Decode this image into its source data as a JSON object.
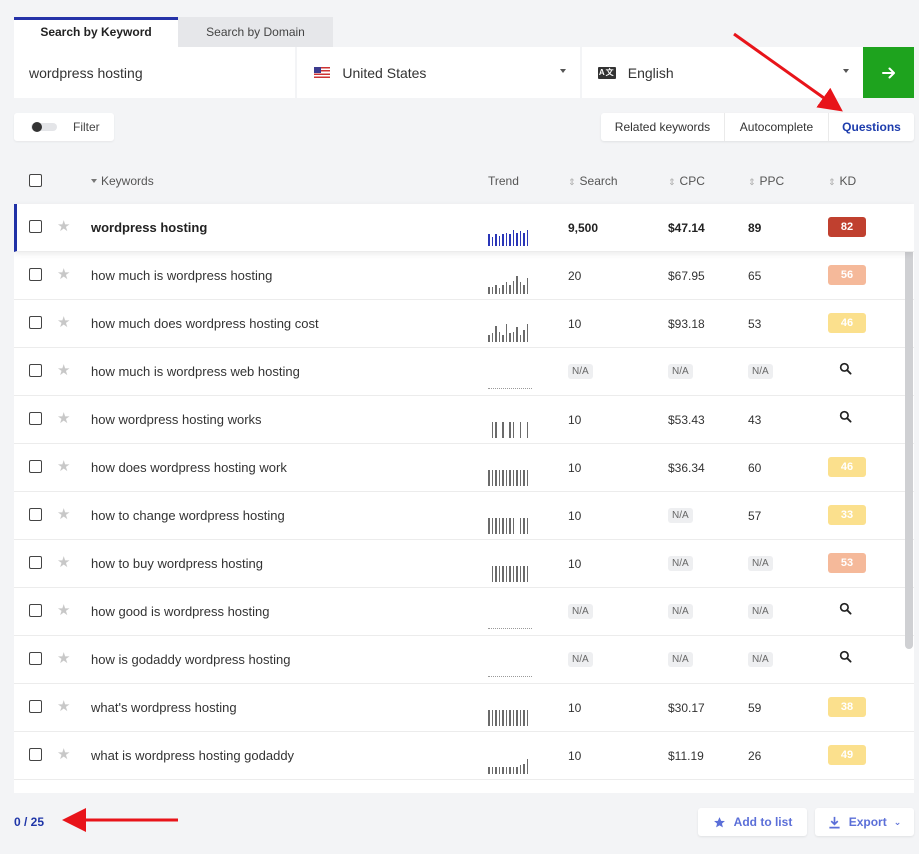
{
  "tabs": [
    {
      "label": "Search by Keyword",
      "active": true
    },
    {
      "label": "Search by Domain",
      "active": false
    }
  ],
  "search": {
    "keyword_value": "wordpress hosting",
    "location": "United States",
    "language": "English",
    "language_icon_text": "A文",
    "go_icon": "arrow-right-icon"
  },
  "filter": {
    "label": "Filter"
  },
  "modes": [
    {
      "label": "Related keywords",
      "active": false
    },
    {
      "label": "Autocomplete",
      "active": false
    },
    {
      "label": "Questions",
      "active": true
    }
  ],
  "table": {
    "headers": {
      "keywords": "Keywords",
      "trend": "Trend",
      "search": "Search",
      "cpc": "CPC",
      "ppc": "PPC",
      "kd": "KD"
    },
    "rows": [
      {
        "keyword": "wordpress hosting",
        "search": "9,500",
        "cpc": "$47.14",
        "ppc": "89",
        "kd": "82",
        "kd_color": "#c0402f",
        "highlight": true,
        "trend": [
          0.4,
          0.3,
          0.4,
          0.35,
          0.4,
          0.45,
          0.4,
          0.55,
          0.45,
          0.5,
          0.45,
          0.55
        ]
      },
      {
        "keyword": "how much is wordpress hosting",
        "search": "20",
        "cpc": "$67.95",
        "ppc": "65",
        "kd": "56",
        "kd_color": "#f5b99a",
        "trend": [
          0.25,
          0.25,
          0.3,
          0.2,
          0.3,
          0.4,
          0.3,
          0.45,
          0.6,
          0.4,
          0.3,
          0.55
        ]
      },
      {
        "keyword": "how much does wordpress hosting cost",
        "search": "10",
        "cpc": "$93.18",
        "ppc": "53",
        "kd": "46",
        "kd_color": "#fbe08d",
        "trend": [
          0.25,
          0.3,
          0.55,
          0.35,
          0.25,
          0.6,
          0.3,
          0.35,
          0.5,
          0.25,
          0.4,
          0.6
        ]
      },
      {
        "keyword": "how much is wordpress web hosting",
        "search": "N/A",
        "cpc": "N/A",
        "ppc": "N/A",
        "kd": "search",
        "kd_color": "",
        "trend": []
      },
      {
        "keyword": "how wordpress hosting works",
        "search": "10",
        "cpc": "$53.43",
        "ppc": "43",
        "kd": "search",
        "kd_color": "",
        "trend": [
          0,
          0.55,
          0.55,
          0,
          0.55,
          0,
          0.55,
          0.55,
          0,
          0.55,
          0,
          0.55
        ]
      },
      {
        "keyword": "how does wordpress hosting work",
        "search": "10",
        "cpc": "$36.34",
        "ppc": "60",
        "kd": "46",
        "kd_color": "#fbe08d",
        "trend": [
          0.55,
          0.55,
          0.55,
          0.55,
          0.55,
          0.55,
          0.55,
          0.55,
          0.55,
          0.55,
          0.55,
          0.55
        ]
      },
      {
        "keyword": "how to change wordpress hosting",
        "search": "10",
        "cpc": "N/A",
        "ppc": "57",
        "kd": "33",
        "kd_color": "#fbe08d",
        "trend": [
          0.55,
          0.55,
          0.55,
          0.55,
          0.55,
          0.55,
          0.55,
          0.55,
          0,
          0.55,
          0.55,
          0.55
        ]
      },
      {
        "keyword": "how to buy wordpress hosting",
        "search": "10",
        "cpc": "N/A",
        "ppc": "N/A",
        "kd": "53",
        "kd_color": "#f5b99a",
        "trend": [
          0,
          0.55,
          0.55,
          0.55,
          0.55,
          0.55,
          0.55,
          0.55,
          0.55,
          0.55,
          0.55,
          0.55
        ]
      },
      {
        "keyword": "how good is wordpress hosting",
        "search": "N/A",
        "cpc": "N/A",
        "ppc": "N/A",
        "kd": "search",
        "kd_color": "",
        "trend": []
      },
      {
        "keyword": "how is godaddy wordpress hosting",
        "search": "N/A",
        "cpc": "N/A",
        "ppc": "N/A",
        "kd": "search",
        "kd_color": "",
        "trend": []
      },
      {
        "keyword": "what's wordpress hosting",
        "search": "10",
        "cpc": "$30.17",
        "ppc": "59",
        "kd": "38",
        "kd_color": "#fbe08d",
        "trend": [
          0.55,
          0.55,
          0.55,
          0.55,
          0.55,
          0.55,
          0.55,
          0.55,
          0.55,
          0.55,
          0.55,
          0.55
        ]
      },
      {
        "keyword": "what is wordpress hosting godaddy",
        "search": "10",
        "cpc": "$11.19",
        "ppc": "26",
        "kd": "49",
        "kd_color": "#fbe08d",
        "trend": [
          0.25,
          0.25,
          0.25,
          0.25,
          0.25,
          0.25,
          0.25,
          0.25,
          0.25,
          0.3,
          0.35,
          0.5
        ]
      }
    ]
  },
  "footer": {
    "count": "0 / 25",
    "add_to_list": "Add to list",
    "export": "Export"
  },
  "colors": {
    "accent": "#2532a8",
    "go_button": "#1ea31e",
    "annotation_arrow": "#e8141a"
  }
}
